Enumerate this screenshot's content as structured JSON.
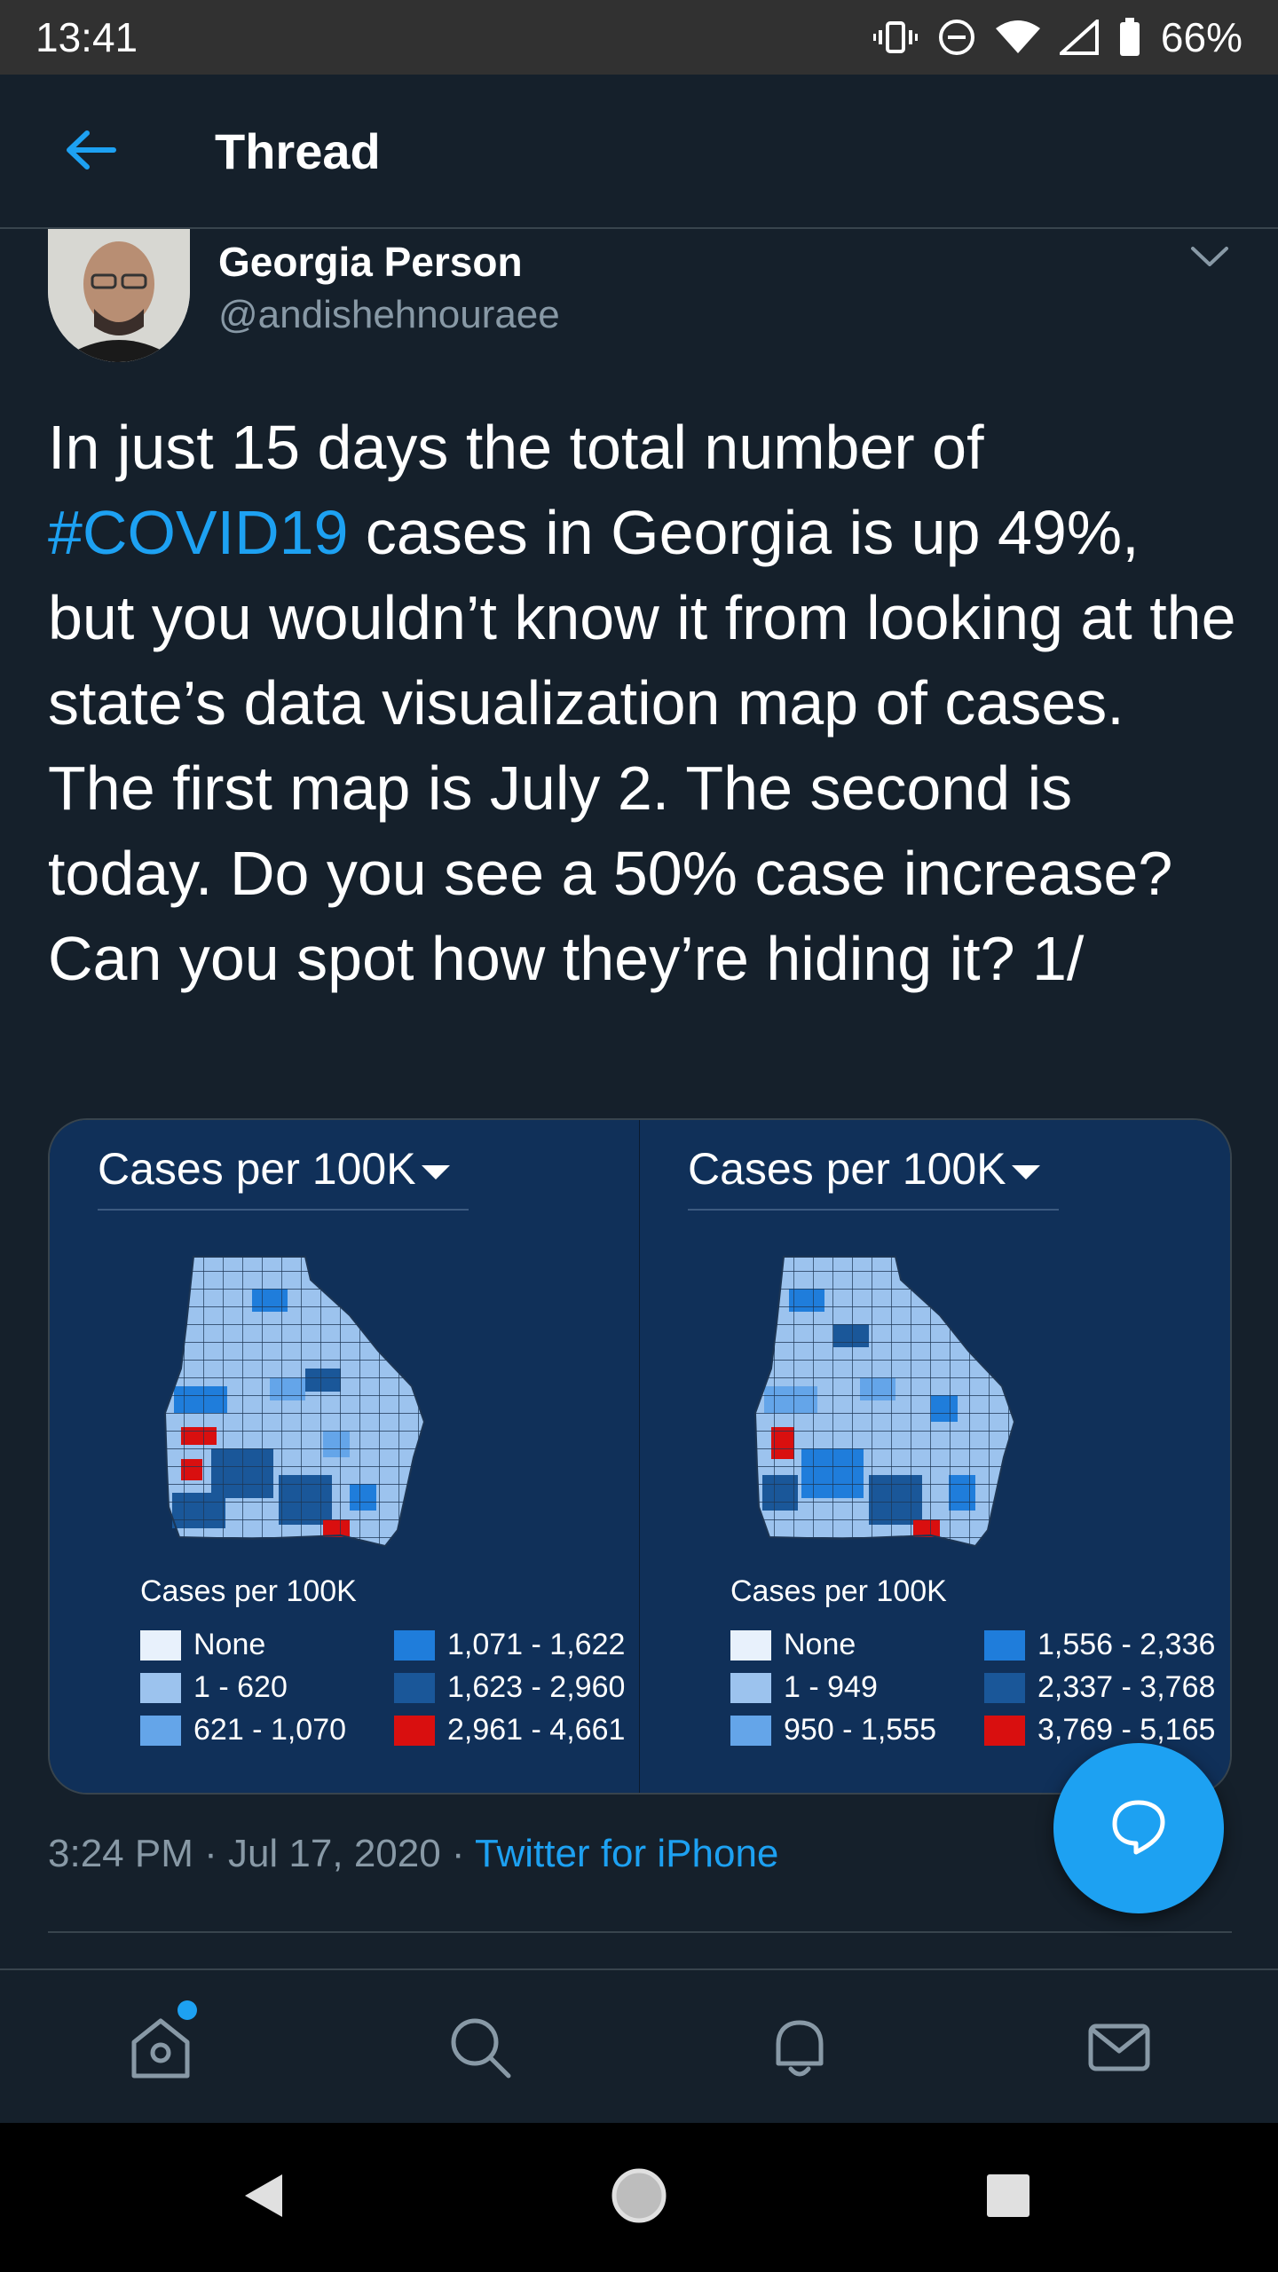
{
  "status_bar": {
    "time": "13:41",
    "battery": "66%",
    "icons": [
      "vibrate-icon",
      "do-not-disturb-icon",
      "wifi-icon",
      "signal-icon",
      "battery-icon"
    ]
  },
  "header": {
    "title": "Thread",
    "back_icon": "arrow-left-icon"
  },
  "tweet": {
    "author_name": "Georgia Person",
    "author_handle": "@andishehnouraee",
    "text_before": "In just 15 days the total number of ",
    "hashtag": "#COVID19",
    "text_after": " cases in Georgia is up 49%, but you wouldn’t know it from looking at the state’s data visualization map of cases. The first map is July 2. The second is today. Do you see a 50% case increase? Can you spot how they’re hiding it? 1/",
    "timestamp": "3:24 PM · Jul 17, 2020 · ",
    "source": "Twitter for iPhone"
  },
  "media": {
    "left": {
      "title": "Cases per 100K",
      "legend_title": "Cases per 100K",
      "legend": [
        {
          "label": "None",
          "color": "#e8f1fc"
        },
        {
          "label": "1 - 620",
          "color": "#9cc3ee"
        },
        {
          "label": "621 - 1,070",
          "color": "#64a5e9"
        },
        {
          "label": "1,071 - 1,622",
          "color": "#1f7ddb"
        },
        {
          "label": "1,623 - 2,960",
          "color": "#1a5799"
        },
        {
          "label": "2,961 - 4,661",
          "color": "#d90f0f"
        }
      ]
    },
    "right": {
      "title": "Cases per 100K",
      "legend_title": "Cases per 100K",
      "legend": [
        {
          "label": "None",
          "color": "#e8f1fc"
        },
        {
          "label": "1 - 949",
          "color": "#9cc3ee"
        },
        {
          "label": "950 - 1,555",
          "color": "#64a5e9"
        },
        {
          "label": "1,556 - 2,336",
          "color": "#1f7ddb"
        },
        {
          "label": "2,337 - 3,768",
          "color": "#1a5799"
        },
        {
          "label": "3,769 - 5,165",
          "color": "#d90f0f"
        }
      ]
    }
  },
  "bottom_nav": {
    "items": [
      "home-icon",
      "search-icon",
      "notifications-icon",
      "messages-icon"
    ]
  },
  "fab": {
    "icon": "reply-bubble-icon"
  },
  "colors": {
    "accent": "#1da1f2",
    "background": "#15202b",
    "muted": "#8899a6"
  }
}
